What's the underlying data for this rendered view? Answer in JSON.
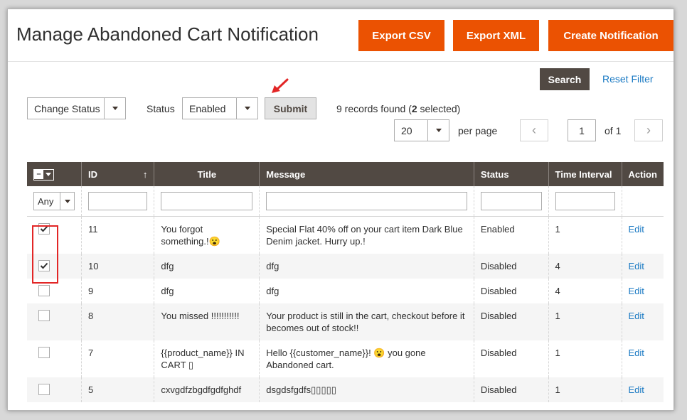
{
  "header": {
    "title": "Manage Abandoned Cart Notification",
    "export_csv": "Export CSV",
    "export_xml": "Export XML",
    "create_notification": "Create Notification"
  },
  "filters_bar": {
    "search": "Search",
    "reset_filter": "Reset Filter"
  },
  "mass_action": {
    "action_select": "Change Status",
    "status_label": "Status",
    "status_value": "Enabled",
    "submit": "Submit"
  },
  "records": {
    "prefix": "9 records found (",
    "selected_count": "2",
    "suffix": " selected)"
  },
  "pager": {
    "per_page_value": "20",
    "per_page_label": "per page",
    "prev": "‹",
    "current_page": "1",
    "of_label": "of 1",
    "next": "›"
  },
  "grid": {
    "columns": {
      "id": "ID",
      "title": "Title",
      "message": "Message",
      "status": "Status",
      "time_interval": "Time Interval",
      "action": "Action"
    },
    "sort_arrow": "↑",
    "mass_select_symbol": "–",
    "filter_any": "Any",
    "rows": [
      {
        "checked": true,
        "id": "11",
        "title": "You forgot something.!😮",
        "message": "Special Flat 40% off on your cart item Dark Blue Denim jacket. Hurry up.!",
        "status": "Enabled",
        "interval": "1",
        "action": "Edit"
      },
      {
        "checked": true,
        "id": "10",
        "title": "dfg",
        "message": "dfg",
        "status": "Disabled",
        "interval": "4",
        "action": "Edit"
      },
      {
        "checked": false,
        "id": "9",
        "title": "dfg",
        "message": "dfg",
        "status": "Disabled",
        "interval": "4",
        "action": "Edit"
      },
      {
        "checked": false,
        "id": "8",
        "title": "You missed !!!!!!!!!!!",
        "message": "Your product is still in the cart, checkout before it becomes out of stock!!",
        "status": "Disabled",
        "interval": "1",
        "action": "Edit"
      },
      {
        "checked": false,
        "id": "7",
        "title": "{{product_name}} IN CART ▯",
        "message": "Hello {{customer_name}}! 😮 you gone Abandoned cart.",
        "status": "Disabled",
        "interval": "1",
        "action": "Edit"
      },
      {
        "checked": false,
        "id": "5",
        "title": "cxvgdfzbgdfgdfghdf",
        "message": "dsgdsfgdfs▯▯▯▯▯",
        "status": "Disabled",
        "interval": "1",
        "action": "Edit"
      }
    ]
  },
  "colors": {
    "accent": "#eb5202",
    "header_dark": "#514943",
    "link": "#1979c3",
    "highlight": "#e22626"
  }
}
